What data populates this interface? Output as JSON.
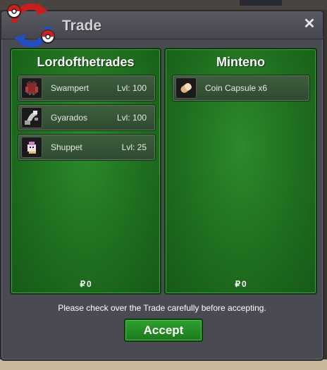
{
  "window": {
    "title": "Trade",
    "close_label": "✕",
    "notice": "Please check over the Trade carefully before accepting.",
    "accept_label": "Accept"
  },
  "left_panel": {
    "player": "Lordofthetrades",
    "items": [
      {
        "name": "Swampert",
        "level": "Lvl: 100",
        "icon": "swampert-icon"
      },
      {
        "name": "Gyarados",
        "level": "Lvl: 100",
        "icon": "gyarados-icon"
      },
      {
        "name": "Shuppet",
        "level": "Lvl: 25",
        "icon": "shuppet-icon"
      }
    ],
    "money_symbol": "₽",
    "money": "0"
  },
  "right_panel": {
    "player": "Minteno",
    "items": [
      {
        "name": "Coin Capsule x6",
        "level": "",
        "icon": "coin-capsule-icon"
      }
    ],
    "money_symbol": "₽",
    "money": "0"
  }
}
